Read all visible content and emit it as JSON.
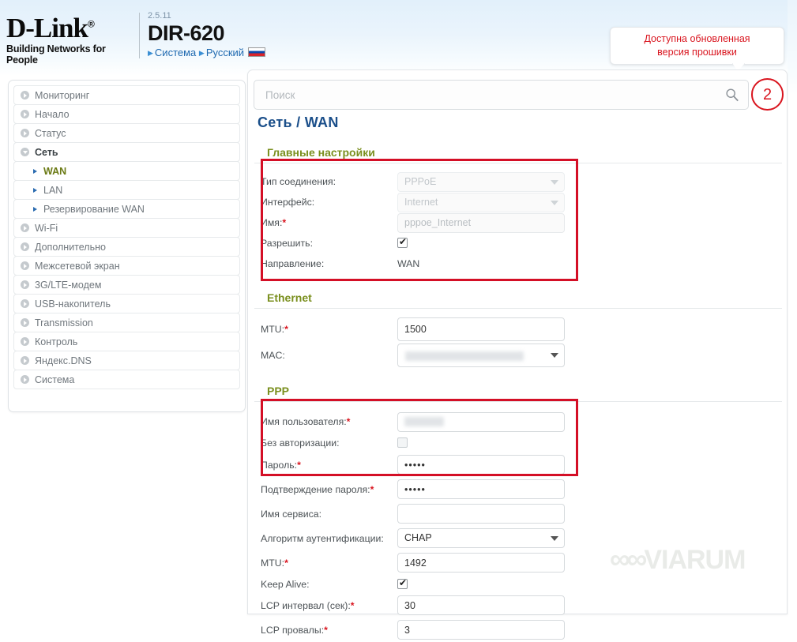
{
  "header": {
    "logo_text": "D-Link",
    "logo_reg": "®",
    "tagline": "Building Networks for People",
    "firmware_version": "2.5.11",
    "model": "DIR-620",
    "breadcrumb": [
      {
        "label": "Система"
      },
      {
        "label": "Русский"
      }
    ],
    "flag": "ru-flag-icon"
  },
  "notice": {
    "line1": "Доступна обновленная",
    "line2": "версия прошивки",
    "color": "#d9151f"
  },
  "sidebar": {
    "items": [
      {
        "label": "Мониторинг",
        "type": "top",
        "state": "collapsed"
      },
      {
        "label": "Начало",
        "type": "top",
        "state": "collapsed"
      },
      {
        "label": "Статус",
        "type": "top",
        "state": "collapsed"
      },
      {
        "label": "Сеть",
        "type": "top",
        "state": "expanded"
      },
      {
        "label": "WAN",
        "type": "sub",
        "state": "active"
      },
      {
        "label": "LAN",
        "type": "sub",
        "state": "normal"
      },
      {
        "label": "Резервирование WAN",
        "type": "sub",
        "state": "normal"
      },
      {
        "label": "Wi-Fi",
        "type": "top",
        "state": "collapsed"
      },
      {
        "label": "Дополнительно",
        "type": "top",
        "state": "collapsed"
      },
      {
        "label": "Межсетевой экран",
        "type": "top",
        "state": "collapsed"
      },
      {
        "label": "3G/LTE-модем",
        "type": "top",
        "state": "collapsed"
      },
      {
        "label": "USB-накопитель",
        "type": "top",
        "state": "collapsed"
      },
      {
        "label": "Transmission",
        "type": "top",
        "state": "collapsed"
      },
      {
        "label": "Контроль",
        "type": "top",
        "state": "collapsed"
      },
      {
        "label": "Яндекс.DNS",
        "type": "top",
        "state": "collapsed"
      },
      {
        "label": "Система",
        "type": "top",
        "state": "collapsed"
      }
    ]
  },
  "search": {
    "placeholder": "Поиск",
    "value": "",
    "icon": "search-icon"
  },
  "badge": {
    "count": "2",
    "color": "#d9151f"
  },
  "page": {
    "title": "Сеть /  WAN"
  },
  "sections": {
    "main": {
      "title": "Главные настройки",
      "conn_type_label": "Тип соединения:",
      "conn_type_value": "PPPoE",
      "interface_label": "Интерфейс:",
      "interface_value": "Internet",
      "name_label": "Имя:",
      "name_value": "pppoe_Internet",
      "enable_label": "Разрешить:",
      "enable_checked": true,
      "direction_label": "Направление:",
      "direction_value": "WAN"
    },
    "ethernet": {
      "title": "Ethernet",
      "mtu_label": "MTU:",
      "mtu_value": "1500",
      "mac_label": "MAC:",
      "mac_value": "",
      "icon_clone": "ethernet-port-icon",
      "icon_clone_disabled": "ethernet-port-disabled-icon"
    },
    "ppp": {
      "title": "PPP",
      "username_label": "Имя пользователя:",
      "username_value": "",
      "noauth_label": "Без авторизации:",
      "noauth_checked": false,
      "password_label": "Пароль:",
      "password_value": "•••••",
      "password_confirm_label": "Подтверждение пароля:",
      "password_confirm_value": "•••••",
      "service_label": "Имя сервиса:",
      "service_value": "",
      "auth_algo_label": "Алгоритм аутентификации:",
      "auth_algo_value": "CHAP",
      "mtu_label": "MTU:",
      "mtu_value": "1492",
      "keepalive_label": "Keep Alive:",
      "keepalive_checked": true,
      "lcp_interval_label": "LCP интервал (сек):",
      "lcp_interval_value": "30",
      "lcp_fail_label": "LCP провалы:",
      "lcp_fail_value": "3"
    }
  },
  "watermark": {
    "text": "VIARUM"
  }
}
